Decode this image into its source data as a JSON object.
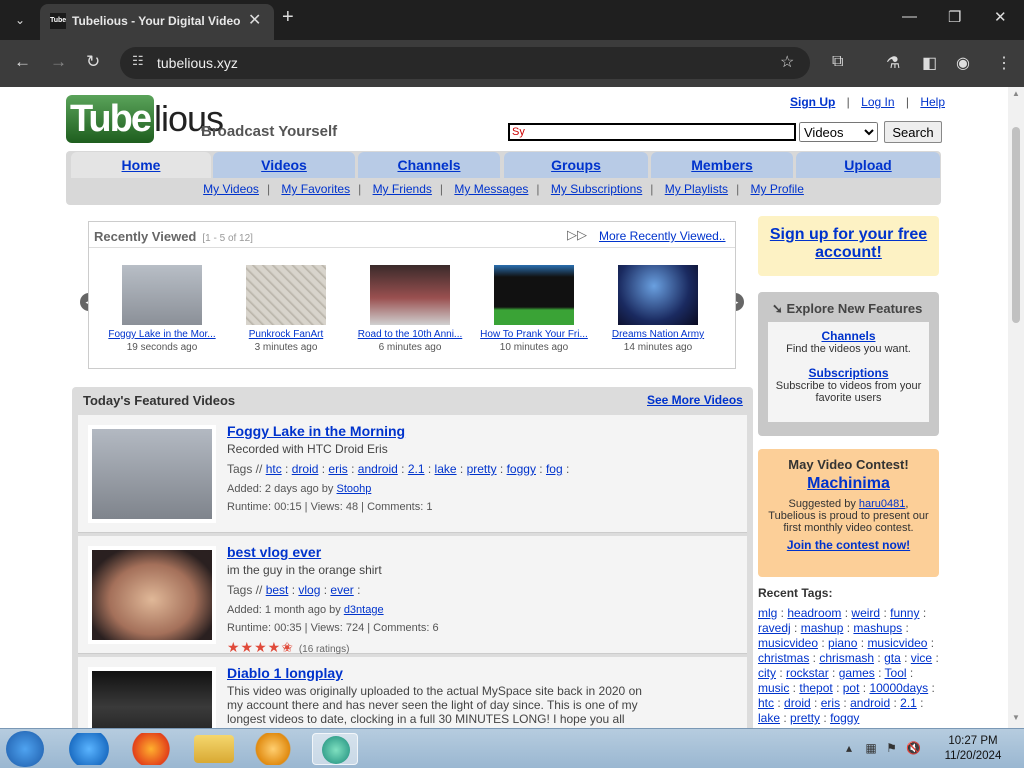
{
  "browser": {
    "tab_title": "Tubelious - Your Digital Video",
    "favicon_text": "Tube",
    "url": "tubelious.xyz"
  },
  "site": {
    "logo_part1": "Tube",
    "logo_part2": "lious",
    "tagline": "Broadcast Yourself",
    "top_links": {
      "signup": "Sign Up",
      "login": "Log In",
      "help": "Help"
    },
    "search": {
      "value": "Sy",
      "category": "Videos",
      "button": "Search"
    }
  },
  "nav": {
    "tabs": [
      "Home",
      "Videos",
      "Channels",
      "Groups",
      "Members",
      "Upload"
    ],
    "subnav": [
      "My Videos",
      "My Favorites",
      "My Friends",
      "My Messages",
      "My Subscriptions",
      "My Playlists",
      "My Profile"
    ]
  },
  "recently_viewed": {
    "title": "Recently Viewed",
    "count": "[1 - 5 of 12]",
    "more": "More Recently Viewed..",
    "items": [
      {
        "caption": "Foggy Lake in the Mor...",
        "ago": "19 seconds ago"
      },
      {
        "caption": "Punkrock FanArt",
        "ago": "3 minutes ago"
      },
      {
        "caption": "Road to the 10th Anni...",
        "ago": "6 minutes ago"
      },
      {
        "caption": "How To Prank Your Fri...",
        "ago": "10 minutes ago"
      },
      {
        "caption": "Dreams Nation Army",
        "ago": "14 minutes ago"
      }
    ]
  },
  "featured": {
    "title": "Today's Featured Videos",
    "see_more": "See More Videos",
    "videos": [
      {
        "title": "Foggy Lake in the Morning",
        "desc": "Recorded with HTC Droid Eris",
        "tags": [
          "htc",
          "droid",
          "eris",
          "android",
          "2.1",
          "lake",
          "pretty",
          "foggy",
          "fog"
        ],
        "added": "2 days ago",
        "by": "Stoohp",
        "runtime": "00:15",
        "views": "48",
        "comments": "1"
      },
      {
        "title": "best vlog ever",
        "desc": "im the guy in the orange shirt",
        "tags": [
          "best",
          "vlog",
          "ever"
        ],
        "added": "1 month ago",
        "by": "d3ntage",
        "runtime": "00:35",
        "views": "724",
        "comments": "6",
        "ratings": "(16 ratings)",
        "rating": 4.5
      },
      {
        "title": "Diablo 1 longplay",
        "desc": "This video was originally uploaded to the actual MySpace site back in 2020 on my account there and has never seen the light of day since. This is one of my longest videos to date, clocking in a full 30 MINUTES LONG! I hope you all"
      }
    ]
  },
  "sidebar": {
    "signup": "Sign up for your free account!",
    "explore": {
      "title": "Explore New Features",
      "channels": "Channels",
      "channels_desc": "Find the videos you want.",
      "subs": "Subscriptions",
      "subs_desc": "Subscribe to videos from your favorite users"
    },
    "contest": {
      "title": "May Video Contest!",
      "name": "Machinima",
      "suggested_pre": "Suggested by",
      "suggested_by": "haru0481",
      "text": "Tubelious is proud to present our first monthly video contest.",
      "join": "Join the contest now!"
    },
    "recent_tags_title": "Recent Tags:",
    "recent_tags": [
      "mlg",
      "headroom",
      "weird",
      "funny",
      "ravedj",
      "mashup",
      "mashups",
      "musicvideo",
      "piano",
      "musicvideo",
      "christmas",
      "chrismash",
      "gta",
      "vice",
      "city",
      "rockstar",
      "games",
      "Tool",
      "music",
      "thepot",
      "pot",
      "10000days",
      "htc",
      "droid",
      "eris",
      "android",
      "2.1",
      "lake",
      "pretty",
      "foggy"
    ]
  },
  "taskbar": {
    "time": "10:27 PM",
    "date": "11/20/2024"
  }
}
